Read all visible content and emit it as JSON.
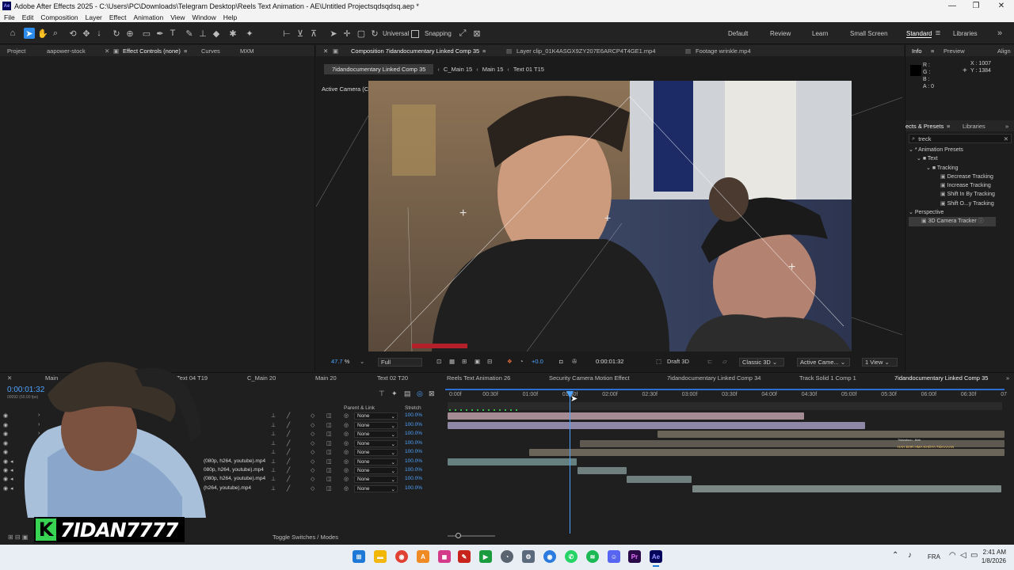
{
  "titlebar": {
    "app_logo": "Ae",
    "title": "Adobe After Effects 2025 - C:\\Users\\PC\\Downloads\\Telegram Desktop\\Reels Text Animation - AE\\Untitled Projectsqdsqdsq.aep *",
    "minimize": "—",
    "maximize": "❐",
    "close": "✕"
  },
  "menu": [
    "File",
    "Edit",
    "Composition",
    "Layer",
    "Effect",
    "Animation",
    "View",
    "Window",
    "Help"
  ],
  "toolbar": {
    "universal_label": "Universal",
    "snapping_label": "Snapping",
    "workspaces": [
      "Default",
      "Review",
      "Learn",
      "Small Screen",
      "Standard",
      "Libraries"
    ],
    "active_workspace": "Standard"
  },
  "left_panel": {
    "tabs": [
      "Project",
      "aapower-stock",
      "Effect Controls (none)",
      "Curves",
      "MXM"
    ],
    "active_tab": "Effect Controls (none)"
  },
  "viewer": {
    "tabs": [
      "Composition 7idandocumentary Linked Comp 35",
      "Layer clip_01K4ASGX9ZY207E6ARCP4T4GE1.mp4",
      "Footage wrinkle.mp4"
    ],
    "breadcrumbs": [
      "7idandocumentary Linked Comp 35",
      "C_Main 15",
      "Main 15",
      "Text 01 T15"
    ],
    "camera_label": "Active Camera (Camera 1)",
    "controls": {
      "zoom": "47.7",
      "zoom_unit": "%",
      "resolution": "Full",
      "exposure": "+0.0",
      "timecode": "0:00:01:32",
      "renderer": "Draft 3D",
      "renderer_mode": "Classic 3D",
      "camera": "Active Came...",
      "views": "1 View"
    }
  },
  "info_panel": {
    "tabs": [
      "Info",
      "Preview",
      "Align"
    ],
    "r": "R :",
    "g": "G :",
    "b": "B :",
    "a": "A : 0",
    "x": "X : 1007",
    "y": "Y : 1384"
  },
  "effects_panel": {
    "tabs": [
      "ects & Presets",
      "Libraries"
    ],
    "search_value": "treck",
    "tree": [
      {
        "label": "* Animation Presets",
        "level": 0
      },
      {
        "label": "Text",
        "level": 1
      },
      {
        "label": "Tracking",
        "level": 2
      },
      {
        "label": "Decrease Tracking",
        "level": 3
      },
      {
        "label": "Increase Tracking",
        "level": 3
      },
      {
        "label": "Shift In By Tracking",
        "level": 3
      },
      {
        "label": "Shift O...y Tracking",
        "level": 3
      },
      {
        "label": "Perspective",
        "level": 0
      },
      {
        "label": "3D Camera Tracker",
        "level": 1,
        "selected": true
      }
    ]
  },
  "timeline": {
    "tabs": [
      "Main",
      "Text 04 T19",
      "C_Main 20",
      "Main 20",
      "Text 02 T20",
      "Reels Text Animation 26",
      "Security Camera Motion Effect",
      "7idandocumentary Linked Comp 34",
      "Track Solid 1 Comp 1",
      "7idandocumentary Linked Comp 35"
    ],
    "timecode": "0:00:01:32",
    "timecode_sub": "00092 (60.00 fps)",
    "col_parent": "Parent & Link",
    "col_stretch": "Stretch",
    "ruler": [
      "0:00f",
      "00:30f",
      "01:00f",
      "01:30f",
      "02:00f",
      "02:30f",
      "03:00f",
      "03:30f",
      "04:00f",
      "04:30f",
      "05:00f",
      "05:30f",
      "06:00f",
      "06:30f",
      "07"
    ],
    "layers": [
      {
        "name": "",
        "parent": "None",
        "stretch": "100.0%"
      },
      {
        "name": "",
        "parent": "None",
        "stretch": "100.0%"
      },
      {
        "name": "",
        "parent": "None",
        "stretch": "100.0%"
      },
      {
        "name": "",
        "parent": "None",
        "stretch": "100.0%"
      },
      {
        "name": "",
        "parent": "None",
        "stretch": "100.0%"
      },
      {
        "name": "(080p, h264, youtube).mp4",
        "parent": "None",
        "stretch": "100.0%"
      },
      {
        "name": "080p, h264, youtube).mp4",
        "parent": "None",
        "stretch": "100.0%"
      },
      {
        "name": "(080p, h264, youtube).mp4",
        "parent": "None",
        "stretch": "100.0%"
      },
      {
        "name": "(h264, youtube).mp4",
        "parent": "None",
        "stretch": "100.0%"
      }
    ],
    "clip_text": "HAH BHR HMA KHOYA 7IDAAAAN",
    "clip_text_small": "7idandocu...Mzk",
    "footer": "Toggle Switches / Modes"
  },
  "overlay": {
    "watermark": "7IDAN7777",
    "watermark_logo": "K"
  },
  "taskbar": {
    "lang": "FRA",
    "time": "2:41 AM",
    "date": "1/8/2026"
  },
  "colors": {
    "accent": "#2d8ceb",
    "stretch_blue": "#4ea3ff",
    "watermark_green": "#39d353"
  }
}
